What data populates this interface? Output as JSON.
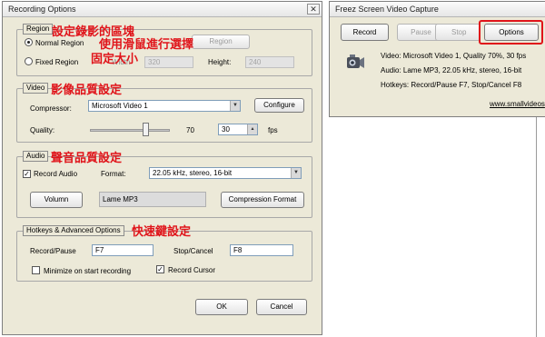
{
  "recording_window": {
    "title": "Recording Options",
    "region": {
      "legend": "Region",
      "normal_label": "Normal Region",
      "fixed_label": "Fixed Region",
      "region_button": "Region",
      "width_label": "Width",
      "width_value": "320",
      "height_label": "Height:",
      "height_value": "240"
    },
    "video": {
      "legend": "Video",
      "compressor_label": "Compressor:",
      "compressor_value": "Microsoft Video 1",
      "configure_button": "Configure",
      "quality_label": "Quality:",
      "quality_value": "70",
      "quality_fraction": 0.7,
      "fps_value": "30",
      "fps_label": "fps"
    },
    "audio": {
      "legend": "Audio",
      "record_audio_label": "Record Audio",
      "format_label": "Format:",
      "format_value": "22.05 kHz, stereo, 16-bit",
      "volume_button": "Volumn",
      "codec_value": "Lame MP3",
      "compression_button": "Compression Format"
    },
    "hotkeys": {
      "legend": "Hotkeys & Advanced Options",
      "record_pause_label": "Record/Pause",
      "record_pause_value": "F7",
      "stop_cancel_label": "Stop/Cancel",
      "stop_cancel_value": "F8",
      "minimize_label": "Minimize on start recording",
      "record_cursor_label": "Record Cursor"
    },
    "ok_button": "OK",
    "cancel_button": "Cancel"
  },
  "capture_window": {
    "title": "Freez Screen Video Capture",
    "record_button": "Record",
    "pause_button": "Pause",
    "stop_button": "Stop",
    "options_button": "Options",
    "info_video": "Video: Microsoft Video 1, Quality 70%, 30 fps",
    "info_audio": "Audio: Lame MP3, 22.05 kHz, stereo, 16-bit",
    "info_hotkeys": "Hotkeys: Record/Pause F7, Stop/Cancel F8",
    "link": "www.smallvideos"
  },
  "annotations": {
    "region_note": "設定錄影的區塊",
    "mouse_note": "使用滑鼠進行選擇",
    "fixed_note": "固定大小",
    "video_note": "影像品質設定",
    "audio_note": "聲音品質設定",
    "hotkey_note": "快速鍵設定"
  },
  "colors": {
    "highlight": "#e0141a",
    "window_bg": "#ece9d8"
  }
}
